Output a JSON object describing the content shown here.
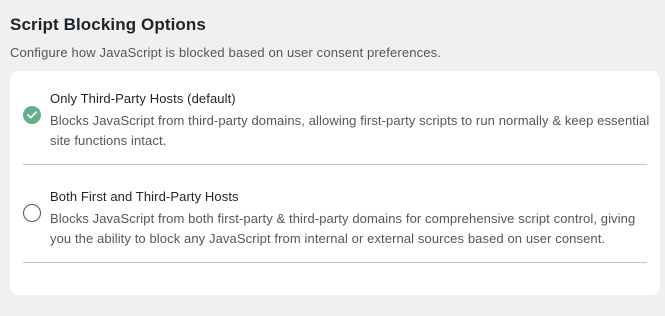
{
  "section": {
    "title": "Script Blocking Options",
    "description": "Configure how JavaScript is blocked based on user consent preferences."
  },
  "options": [
    {
      "label": "Only Third-Party Hosts (default)",
      "description": "Blocks JavaScript from third-party domains, allowing first-party scripts to run normally & keep essential site functions intact.",
      "selected": true
    },
    {
      "label": "Both First and Third-Party Hosts",
      "description": "Blocks JavaScript from both first-party & third-party domains for comprehensive script control, giving you the ability to block any JavaScript from internal or external sources based on user consent.",
      "selected": false
    }
  ],
  "colors": {
    "accent": "#66ad8a",
    "background": "#f0f0f1",
    "card": "#ffffff",
    "divider": "#c3c4c7"
  },
  "icons": {
    "selected": "checkmark-icon"
  }
}
